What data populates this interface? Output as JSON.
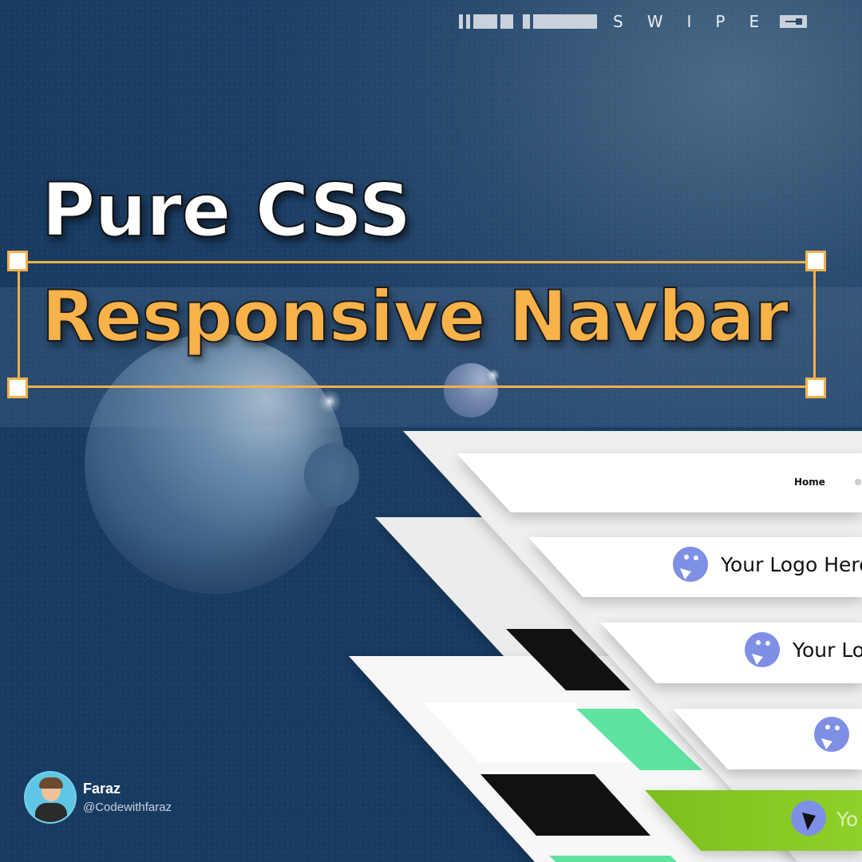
{
  "swipe": {
    "letters": [
      "S",
      "W",
      "I",
      "P",
      "E"
    ]
  },
  "title": {
    "line1": "Pure CSS",
    "line2": "Responsive Navbar"
  },
  "mockups": {
    "nav_link": "Home",
    "logo_text_1": "Your Logo Here",
    "logo_text_2": "Your Lo",
    "logo_text_3": "Yo",
    "accent_colors": {
      "logo_blue": "#7f8fe6",
      "green_light": "#5ee3a0",
      "green_dark": "#7cbe1e",
      "black": "#111111"
    }
  },
  "author": {
    "name": "Faraz",
    "handle": "@Codewithfaraz"
  },
  "colors": {
    "title_white": "#ffffff",
    "title_orange": "#f7b24a",
    "selection_orange": "#f3b14a",
    "background": "#1d3f66"
  }
}
